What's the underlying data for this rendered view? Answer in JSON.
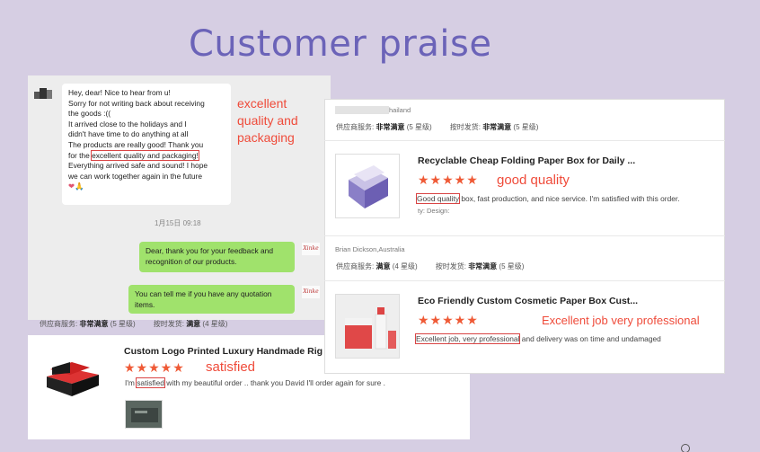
{
  "slide": {
    "title": "Customer praise"
  },
  "chat": {
    "message_lines_before": [
      "Hey, dear! Nice to hear from u!",
      "Sorry for not writing back about receiving",
      "the goods :((",
      "It arrived close to the holidays and I",
      "didn't have time to do anything at all",
      "The products are really good! Thank you"
    ],
    "highlight_prefix": "for the ",
    "highlight_text": "excellent quality and packaging!",
    "message_lines_after": [
      "Everything arrived safe and sound! I hope",
      "we can work together again in the future"
    ],
    "emoji": "❤🙏",
    "annotation_lines": [
      "excellent",
      "quality and",
      "packaging"
    ],
    "timestamp": "1月15日 09:18",
    "reply1": [
      "Dear, thank you for your feedback and",
      "recognition of our products."
    ],
    "reply2": [
      "You can tell me if you have any quotation",
      "items."
    ],
    "logo_text": "Xinke"
  },
  "left_review": {
    "service_label": "供应商服务:",
    "service_value": "非常满意",
    "service_stars": "(5 星级)",
    "ship_label": "按时发货:",
    "ship_value": "满意",
    "ship_stars": "(4 星级)",
    "product_title": "Custom Logo Printed Luxury Handmade Rig",
    "stars": "★★★★★",
    "annotation": "satisfied",
    "text_prefix": "I'm ",
    "text_highlight": "satisfied",
    "text_suffix": " with my beautiful order .. thank you David I'll order again for sure ."
  },
  "right_reviews": [
    {
      "country": "hailand",
      "service_label": "供应商服务:",
      "service_value": "非常满意",
      "service_stars": "(5 星级)",
      "ship_label": "按时发货:",
      "ship_value": "非常满意",
      "ship_stars": "(5 星级)",
      "product_title": "Recyclable Cheap Folding Paper Box for Daily ...",
      "stars": "★★★★★",
      "annotation": "good quality",
      "text_highlight": "Good quality",
      "text_suffix": " box, fast production, and nice service. I'm satisfied with this order.",
      "extra": "ty:    Design:"
    },
    {
      "country": "Brian Dickson,Australia",
      "service_label": "供应商服务:",
      "service_value": "满意",
      "service_stars": "(4 星级)",
      "ship_label": "按时发货:",
      "ship_value": "非常满意",
      "ship_stars": "(5 星级)",
      "product_title": "Eco Friendly Custom Cosmetic Paper Box Cust...",
      "stars": "★★★★★",
      "annotation": "Excellent job very professional",
      "text_highlight": "Excellent job, very professional",
      "text_suffix": " and delivery was on time and undamaged"
    }
  ],
  "colors": {
    "background": "#d6cee3",
    "title": "#6b63b8",
    "annotation": "#ef4b3a",
    "highlight_box": "#d94444",
    "chat_green": "#a0e26c",
    "stars": "#ef5a36"
  }
}
